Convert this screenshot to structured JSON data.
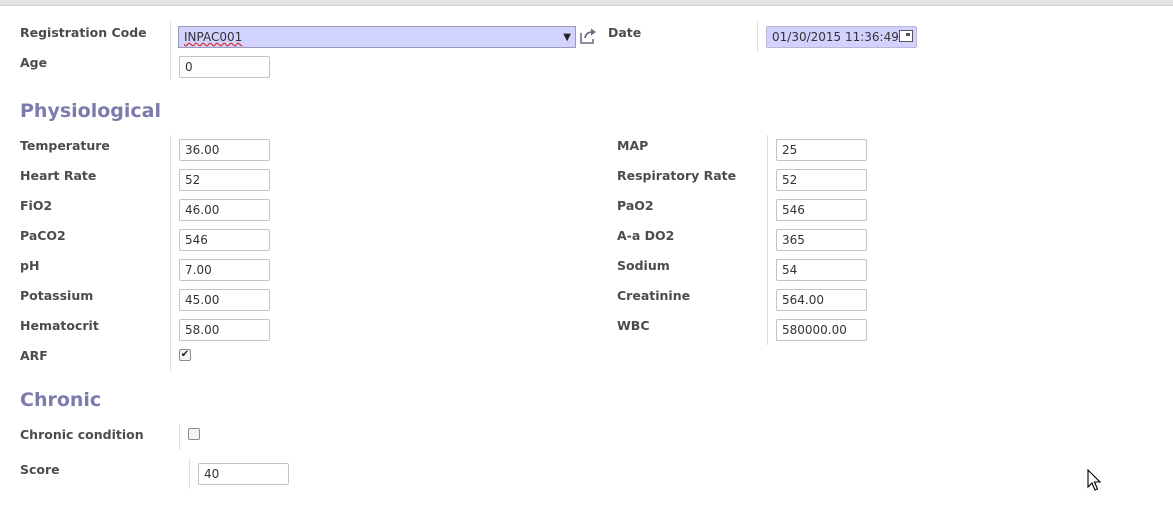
{
  "header": {
    "registration_code_label": "Registration Code",
    "registration_code_value": "INPAC001",
    "date_label": "Date",
    "date_value": "01/30/2015 11:36:49",
    "age_label": "Age",
    "age_value": "0"
  },
  "physiological": {
    "title": "Physiological",
    "left": [
      {
        "label": "Temperature",
        "value": "36.00"
      },
      {
        "label": "Heart Rate",
        "value": "52"
      },
      {
        "label": "FiO2",
        "value": "46.00"
      },
      {
        "label": "PaCO2",
        "value": "546"
      },
      {
        "label": "pH",
        "value": "7.00"
      },
      {
        "label": "Potassium",
        "value": "45.00"
      },
      {
        "label": "Hematocrit",
        "value": "58.00"
      }
    ],
    "arf_label": "ARF",
    "arf_checked": true,
    "right": [
      {
        "label": "MAP",
        "value": "25"
      },
      {
        "label": "Respiratory Rate",
        "value": "52"
      },
      {
        "label": "PaO2",
        "value": "546"
      },
      {
        "label": "A-a DO2",
        "value": "365"
      },
      {
        "label": "Sodium",
        "value": "54"
      },
      {
        "label": "Creatinine",
        "value": "564.00"
      },
      {
        "label": "WBC",
        "value": "580000.00"
      }
    ]
  },
  "chronic": {
    "title": "Chronic",
    "chronic_condition_label": "Chronic condition",
    "chronic_condition_checked": false,
    "score_label": "Score",
    "score_value": "40"
  },
  "icons": {
    "external_link": "external-link-icon",
    "calendar": "calendar-icon",
    "dropdown": "chevron-down-icon",
    "cursor": "mouse-pointer-icon"
  },
  "colors": {
    "section_title": "#7c7bad",
    "required_field_bg": "#d2d2ff",
    "label": "#4c4c4c"
  }
}
